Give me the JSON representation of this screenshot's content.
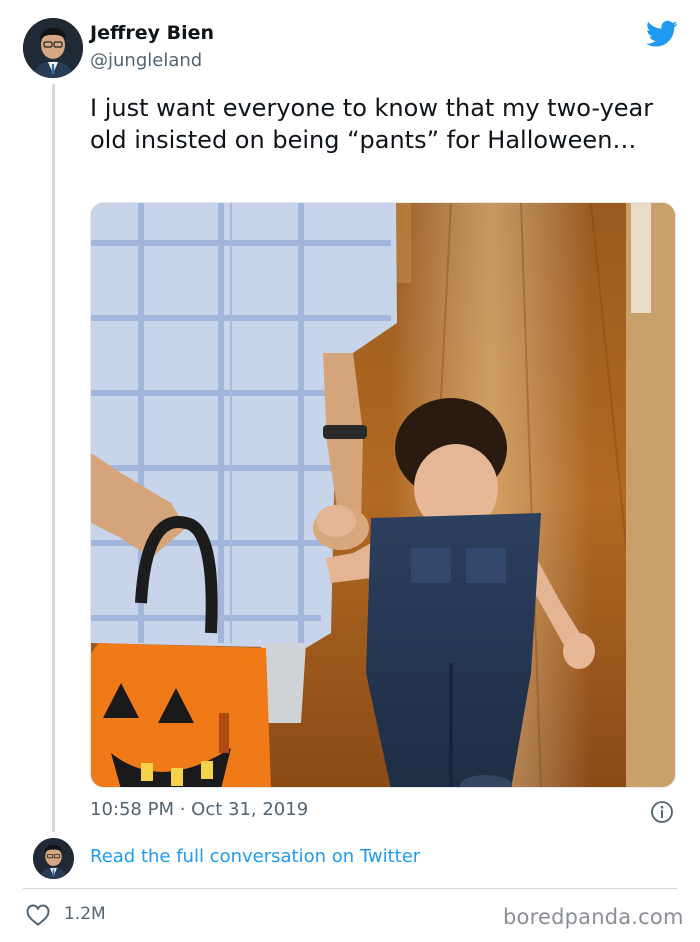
{
  "author": {
    "name": "Jeffrey Bien",
    "handle": "@jungleland"
  },
  "tweet": {
    "text": "I just want everyone to know that my two-year old insisted on being “pants” for Halloween…",
    "timestamp": "10:58 PM · Oct 31, 2019"
  },
  "footer": {
    "read_link": "Read the full conversation on Twitter",
    "likes": "1.2M",
    "watermark": "boredpanda.com"
  },
  "icons": {
    "brand": "twitter-bird-icon",
    "info": "info-icon",
    "like": "heart-icon"
  },
  "colors": {
    "brand_blue": "#1d9bf0",
    "secondary_text": "#536471"
  }
}
